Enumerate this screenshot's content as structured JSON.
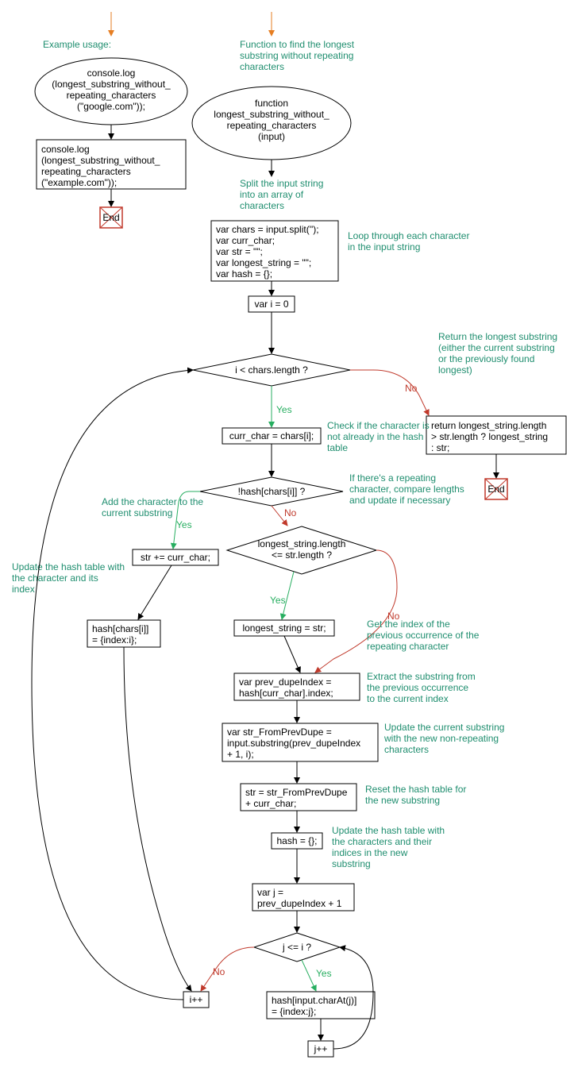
{
  "c_example": "Example usage:",
  "n_example_log1_l1": "console.log",
  "n_example_log1_l2": "(longest_substring_without_",
  "n_example_log1_l3": "repeating_characters",
  "n_example_log1_l4": "(\"google.com\"));",
  "n_example_log2_l1": "console.log",
  "n_example_log2_l2": "(longest_substring_without_",
  "n_example_log2_l3": "repeating_characters",
  "n_example_log2_l4": "(\"example.com\"));",
  "end_label": "End",
  "c_func_l1": "Function to find the longest",
  "c_func_l2": "substring without repeating",
  "c_func_l3": "characters",
  "n_func_l1": "function",
  "n_func_l2": "longest_substring_without_",
  "n_func_l3": "repeating_characters",
  "n_func_l4": "(input)",
  "c_split_l1": "Split the input string",
  "c_split_l2": "into an array of",
  "c_split_l3": "characters",
  "n_vars_l1": "var chars = input.split('');",
  "n_vars_l2": "var curr_char;",
  "n_vars_l3": "var str = \"\";",
  "n_vars_l4": "var longest_string = \"\";",
  "n_vars_l5": "var hash = {};",
  "c_loop_l1": "Loop through each character",
  "c_loop_l2": "in the input string",
  "n_vari0": "var i = 0",
  "d_ilen": "i < chars.length ?",
  "c_ret_l1": "Return the longest substring",
  "c_ret_l2": "(either the current substring",
  "c_ret_l3": "or the previously found",
  "c_ret_l4": "longest)",
  "n_ret_l1": "return longest_string.length",
  "n_ret_l2": "> str.length ? longest_string",
  "n_ret_l3": ": str;",
  "n_curr": "curr_char = chars[i];",
  "c_check_l1": "Check if the character is",
  "c_check_l2": "not already in the hash",
  "c_check_l3": "table",
  "d_hash": "!hash[chars[i]] ?",
  "c_repeat_l1": "If there's a repeating",
  "c_repeat_l2": "character, compare lengths",
  "c_repeat_l3": "and update if necessary",
  "c_add_l1": "Add the character to the",
  "c_add_l2": "current substring",
  "n_strplus": "str += curr_char;",
  "d_lenle_l1": "longest_string.length",
  "d_lenle_l2": "<= str.length ?",
  "c_updhash_l1": "Update the hash table with",
  "c_updhash_l2": "the character and its",
  "c_updhash_l3": "index",
  "n_hashset_l1": "hash[chars[i]]",
  "n_hashset_l2": "= {index:i};",
  "n_longest_set": "longest_string = str;",
  "c_getidx_l1": "Get the index of the",
  "c_getidx_l2": "previous occurrence of the",
  "c_getidx_l3": "repeating character",
  "n_prevdupe_l1": "var prev_dupeIndex =",
  "n_prevdupe_l2": "hash[curr_char].index;",
  "c_extract_l1": "Extract the substring from",
  "c_extract_l2": "the previous occurrence",
  "c_extract_l3": "to the current index",
  "n_strFrom_l1": "var str_FromPrevDupe =",
  "n_strFrom_l2": "input.substring(prev_dupeIndex",
  "n_strFrom_l3": "+ 1, i);",
  "c_updcurr_l1": "Update the current substring",
  "c_updcurr_l2": "with the new non-repeating",
  "c_updcurr_l3": "characters",
  "n_strset_l1": "str = str_FromPrevDupe",
  "n_strset_l2": "+ curr_char;",
  "c_reset_l1": "Reset the hash table for",
  "c_reset_l2": "the new substring",
  "n_hashreset": "hash = {};",
  "c_updnew_l1": "Update the hash table with",
  "c_updnew_l2": "the characters and their",
  "c_updnew_l3": "indices in the new",
  "c_updnew_l4": "substring",
  "n_varj_l1": "var j =",
  "n_varj_l2": "prev_dupeIndex + 1",
  "d_jle": "j <= i ?",
  "n_hashj_l1": "hash[input.charAt(j)]",
  "n_hashj_l2": "= {index:j};",
  "n_jpp": "j++",
  "n_ipp": "i++",
  "yes": "Yes",
  "no": "No"
}
